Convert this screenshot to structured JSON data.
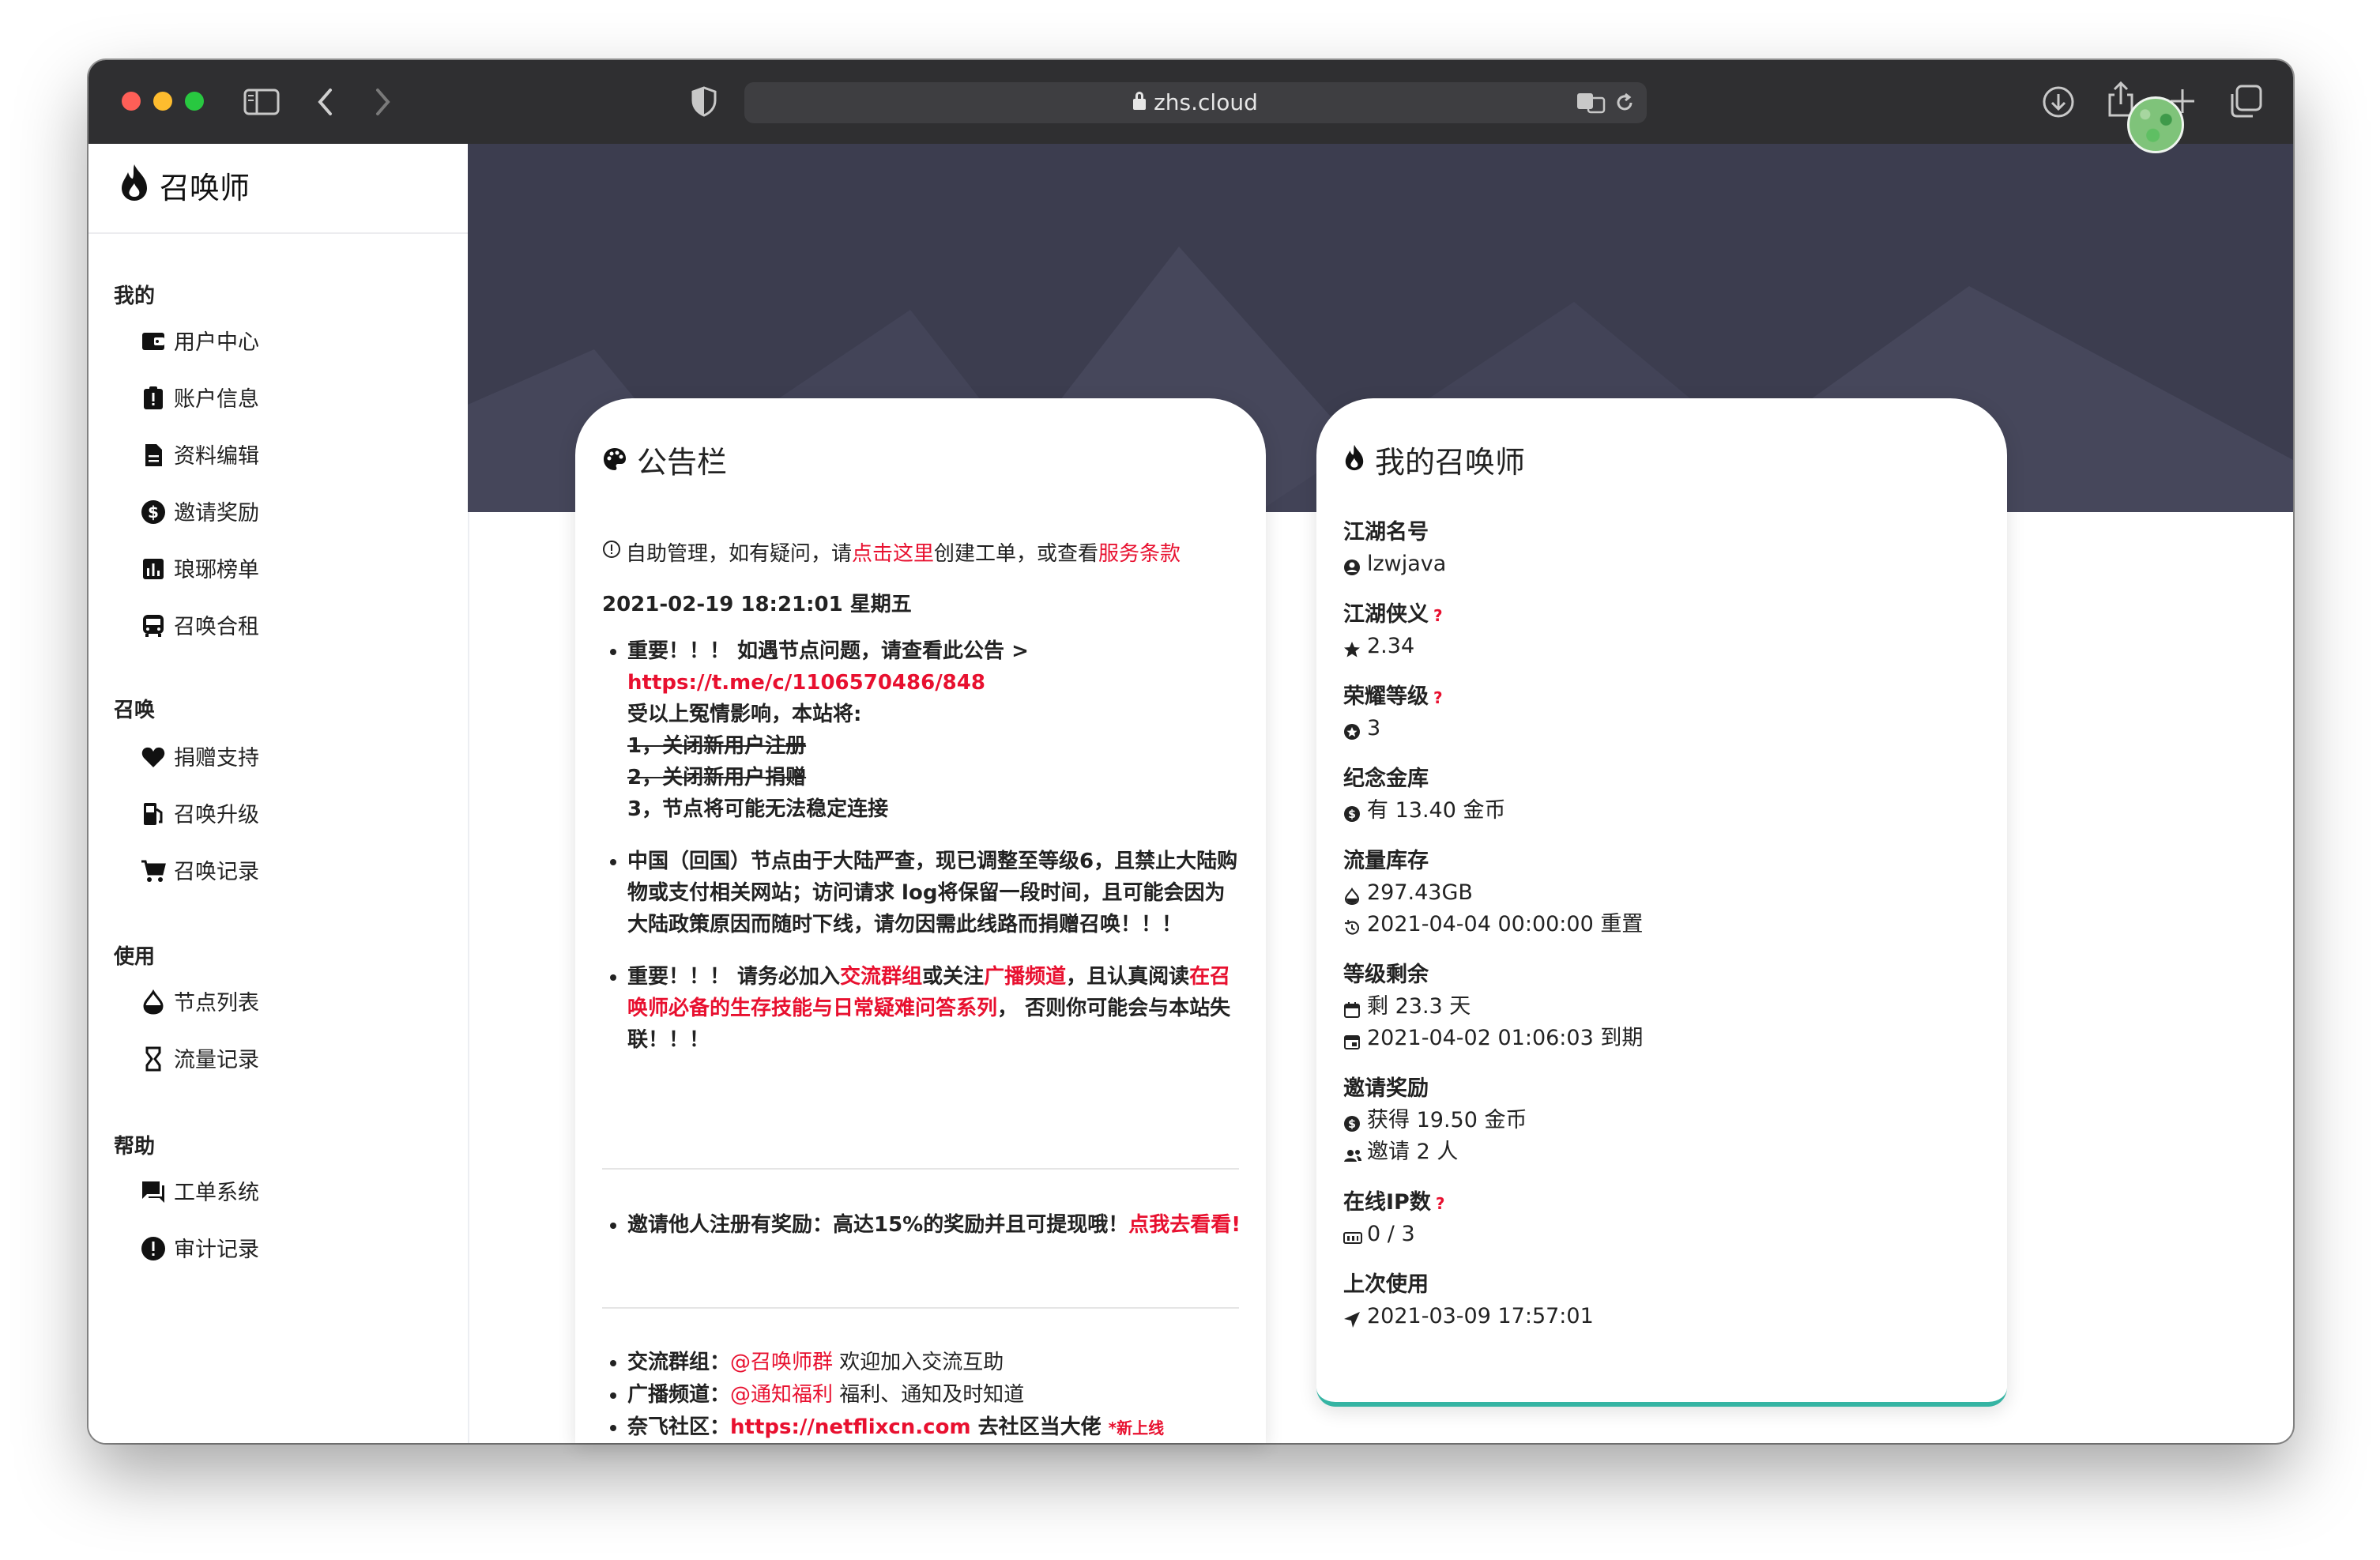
{
  "browser": {
    "url": "zhs.cloud"
  },
  "sidebar": {
    "brand": "召唤师",
    "sections": [
      {
        "title": "我的",
        "items": [
          {
            "label": "用户中心",
            "icon": "wallet-icon"
          },
          {
            "label": "账户信息",
            "icon": "clipboard-alert-icon"
          },
          {
            "label": "资料编辑",
            "icon": "document-icon"
          },
          {
            "label": "邀请奖励",
            "icon": "dollar-circle-icon"
          },
          {
            "label": "琅琊榜单",
            "icon": "bar-chart-icon"
          },
          {
            "label": "召唤合租",
            "icon": "bus-icon"
          }
        ]
      },
      {
        "title": "召唤",
        "items": [
          {
            "label": "捐赠支持",
            "icon": "heart-icon"
          },
          {
            "label": "召唤升级",
            "icon": "fuel-icon"
          },
          {
            "label": "召唤记录",
            "icon": "cart-icon"
          }
        ]
      },
      {
        "title": "使用",
        "items": [
          {
            "label": "节点列表",
            "icon": "drop-icon"
          },
          {
            "label": "流量记录",
            "icon": "hourglass-icon"
          }
        ]
      },
      {
        "title": "帮助",
        "items": [
          {
            "label": "工单系统",
            "icon": "chat-icon"
          },
          {
            "label": "审计记录",
            "icon": "alert-circle-icon"
          }
        ]
      }
    ]
  },
  "header": {
    "title": "用户中心"
  },
  "notice": {
    "title": "公告栏",
    "intro": {
      "p1": "自助管理，如有疑问，请",
      "link1": "点击这里",
      "p2": "创建工单，或查看",
      "link2": "服务条款"
    },
    "date": "2021-02-19 18:21:01 星期五",
    "b1": {
      "line1": "重要！！！ 如遇节点问题，请查看此公告 >",
      "link": "https://t.me/c/1106570486/848",
      "line2": "受以上冤情影响，本站将:",
      "s1": "1，关闭新用户注册",
      "s2": "2，关闭新用户捐赠",
      "line3": "3，节点将可能无法稳定连接"
    },
    "b2": "中国（回国）节点由于大陆严查，现已调整至等级6，且禁止大陆购物或支付相关网站；访问请求 log将保留一段时间，且可能会因为大陆政策原因而随时下线，请勿因需此线路而捐赠召唤！！！",
    "b3": {
      "p1": "重要！！！ 请务必加入",
      "l1": "交流群组",
      "p2": "或关注",
      "l2": "广播频道",
      "p3": "，且认真阅读",
      "l3": "在召唤师必备的生存技能与日常疑难问答系列",
      "p4": "， 否则你可能会与本站失联！！！"
    },
    "b4": {
      "p1": "邀请他人注册有奖励：高达15%的奖励并且可提现哦！",
      "l1": "点我去看看!"
    },
    "links": [
      {
        "label": "交流群组：",
        "link": "@召唤师群",
        "desc": " 欢迎加入交流互助"
      },
      {
        "label": "广播频道：",
        "link": "@通知福利",
        "desc": " 福利、通知及时知道"
      },
      {
        "label": "奈飞社区：",
        "link": "https://netflixcn.com",
        "desc": " 去社区当大佬 ",
        "tag": "*新上线"
      }
    ]
  },
  "summoner": {
    "title": "我的召唤师",
    "stats": [
      {
        "label": "江湖名号",
        "help": "",
        "values": [
          {
            "icon": "user-circle-icon",
            "text": "lzwjava"
          }
        ]
      },
      {
        "label": "江湖侠义",
        "help": "?",
        "values": [
          {
            "icon": "star-icon",
            "text": "2.34"
          }
        ]
      },
      {
        "label": "荣耀等级",
        "help": "?",
        "values": [
          {
            "icon": "badge-icon",
            "text": "3"
          }
        ]
      },
      {
        "label": "纪念金库",
        "help": "",
        "values": [
          {
            "icon": "coin-icon",
            "text": "有 13.40 金币"
          }
        ]
      },
      {
        "label": "流量库存",
        "help": "",
        "values": [
          {
            "icon": "drop-icon",
            "text": "297.43GB"
          },
          {
            "icon": "history-icon",
            "text": "2021-04-04 00:00:00 重置"
          }
        ]
      },
      {
        "label": "等级剩余",
        "help": "",
        "values": [
          {
            "icon": "calendar-icon",
            "text": "剩 23.3 天"
          },
          {
            "icon": "calendar-check-icon",
            "text": "2021-04-02 01:06:03 到期"
          }
        ]
      },
      {
        "label": "邀请奖励",
        "help": "",
        "values": [
          {
            "icon": "coin-icon",
            "text": "获得 19.50 金币"
          },
          {
            "icon": "users-icon",
            "text": "邀请 2 人"
          }
        ]
      },
      {
        "label": "在线IP数",
        "help": "?",
        "values": [
          {
            "icon": "ip-icon",
            "text": "0 / 3"
          }
        ]
      },
      {
        "label": "上次使用",
        "help": "",
        "values": [
          {
            "icon": "navigation-icon",
            "text": "2021-03-09 17:57:01"
          }
        ]
      }
    ]
  }
}
